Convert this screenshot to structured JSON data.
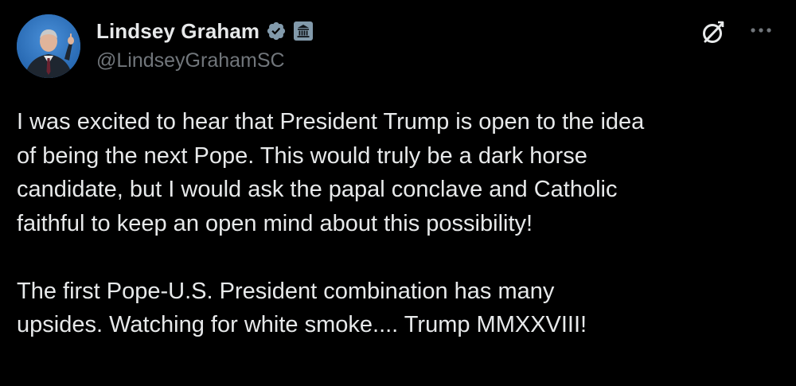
{
  "author": {
    "display_name": "Lindsey Graham",
    "handle": "@LindseyGrahamSC",
    "verified": true,
    "affiliation_badge": "government-building-icon",
    "avatar_alt": "profile-photo"
  },
  "actions": {
    "grok_icon": "grok-slash-circle-icon",
    "more_icon": "more-dots-icon"
  },
  "tweet": {
    "paragraph1_lines": [
      "I was excited to hear that President Trump is open to the idea",
      "of being the next Pope. This would truly be a dark horse",
      "candidate, but I would ask the papal conclave and Catholic",
      "faithful to keep an open mind about this possibility!"
    ],
    "paragraph2_lines": [
      "The first Pope-U.S. President combination has many",
      "upsides. Watching for white smoke.... Trump MMXXVIII!"
    ]
  },
  "colors": {
    "background": "#000000",
    "text": "#e7e9ea",
    "secondary_text": "#71767b",
    "verified_badge": "#829aab",
    "government_badge": "#829aab"
  }
}
